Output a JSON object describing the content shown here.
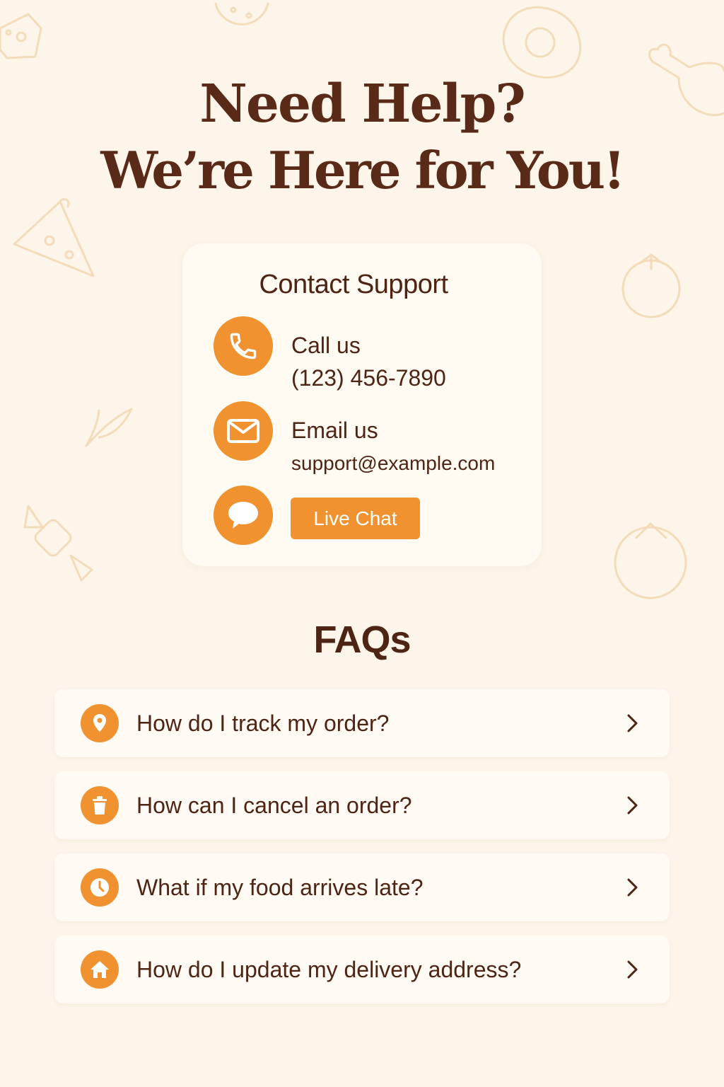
{
  "header": {
    "title_line1": "Need Help?",
    "title_line2": "We’re Here for You!"
  },
  "contact": {
    "title": "Contact Support",
    "call": {
      "icon": "phone-icon",
      "label": "Call us",
      "value": "(123) 456-7890"
    },
    "email": {
      "icon": "envelope-icon",
      "label": "Email us",
      "value": "support@example.com"
    },
    "chat": {
      "icon": "chat-bubble-icon",
      "button_label": "Live Chat"
    }
  },
  "faq": {
    "heading": "FAQs",
    "items": [
      {
        "icon": "location-pin-icon",
        "question": "How do I track my order?"
      },
      {
        "icon": "trash-icon",
        "question": "How can I cancel an order?"
      },
      {
        "icon": "clock-icon",
        "question": "What if my food arrives late?"
      },
      {
        "icon": "home-icon",
        "question": "How do I update my delivery address?"
      }
    ]
  },
  "colors": {
    "background": "#fdf5ea",
    "accent": "#f0922f",
    "text": "#4e2414",
    "card": "#fffaf2"
  }
}
